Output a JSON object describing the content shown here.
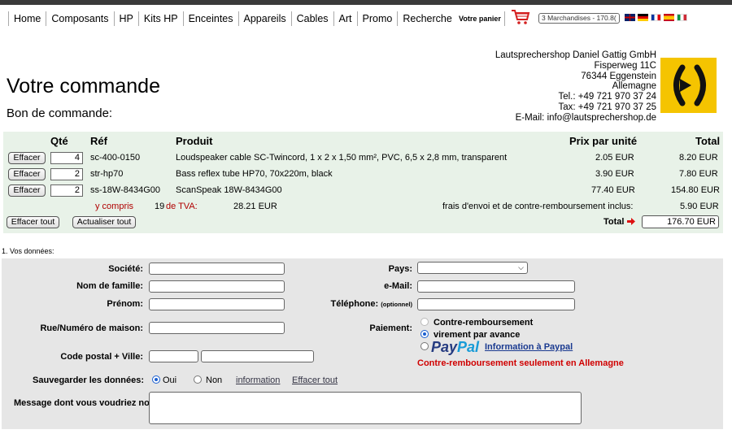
{
  "nav": {
    "items": [
      "Home",
      "Composants",
      "HP",
      "Kits HP",
      "Enceintes",
      "Appareils",
      "Cables",
      "Art",
      "Promo",
      "Recherche"
    ],
    "cart_label": "Votre panier",
    "cart_summary": "3 Marchandises - 170.8(",
    "languages": [
      "English",
      "Deutsch",
      "Français",
      "Español",
      "Italiano"
    ]
  },
  "header": {
    "title": "Votre commande",
    "subtitle": "Bon de commande:",
    "address": [
      "Lautsprechershop Daniel Gattig GmbH",
      "Fisperweg 11C",
      "76344 Eggenstein",
      "Allemagne",
      "Tel.: +49 721 970 37 24",
      "Tax: +49 721 970 37 25",
      "E-Mail: info@lautsprechershop.de"
    ]
  },
  "order": {
    "headers": {
      "qty": "Qté",
      "ref": "Réf",
      "product": "Produit",
      "unit_price": "Prix par unité",
      "total": "Total"
    },
    "delete_label": "Effacer",
    "rows": [
      {
        "qty": "4",
        "ref": "sc-400-0150",
        "product": "Loudspeaker cable SC-Twincord, 1 x 2 x 1,50 mm², PVC, 6,5 x 2,8 mm, transparent",
        "unit_price": "2.05 EUR",
        "total": "8.20 EUR"
      },
      {
        "qty": "2",
        "ref": "str-hp70",
        "product": "Bass reflex tube HP70, 70x220m, black",
        "unit_price": "3.90 EUR",
        "total": "7.80 EUR"
      },
      {
        "qty": "2",
        "ref": "ss-18W-8434G00",
        "product": "ScanSpeak 18W-8434G00",
        "unit_price": "77.40 EUR",
        "total": "154.80 EUR"
      }
    ],
    "tax_prefix": "y compris",
    "tax_rate": "19",
    "tax_suffix": "de TVA:",
    "tax_amount": "28.21 EUR",
    "shipping_label": "frais d'envoi et de contre-remboursement inclus:",
    "shipping_amount": "5.90 EUR",
    "clear_all": "Effacer tout",
    "update_all": "Actualiser tout",
    "grand_total_label": "Total",
    "grand_total": "176.70 EUR"
  },
  "form": {
    "section": "1. Vos données:",
    "labels": {
      "company": "Société:",
      "last_name": "Nom de famille:",
      "first_name": "Prénom:",
      "street": "Rue/Numéro de maison:",
      "postal_city": "Code postal + Ville:",
      "save": "Sauvegarder les données:",
      "message": "Message dont vous voudriez nous faire part:",
      "country": "Pays:",
      "email": "e-Mail:",
      "phone": "Téléphone:",
      "phone_optional": "(optionnel)",
      "payment": "Paiement:"
    },
    "payment_options": [
      "Contre-remboursement",
      "virement par avance"
    ],
    "paypal_1": "Pay",
    "paypal_2": "Pal",
    "paypal_info": "Information à Paypal",
    "warning": "Contre-remboursement seulement en Allemagne",
    "save_yes": "Oui",
    "save_no": "Non",
    "info_link": "information",
    "clear_link": "Effacer tout"
  }
}
